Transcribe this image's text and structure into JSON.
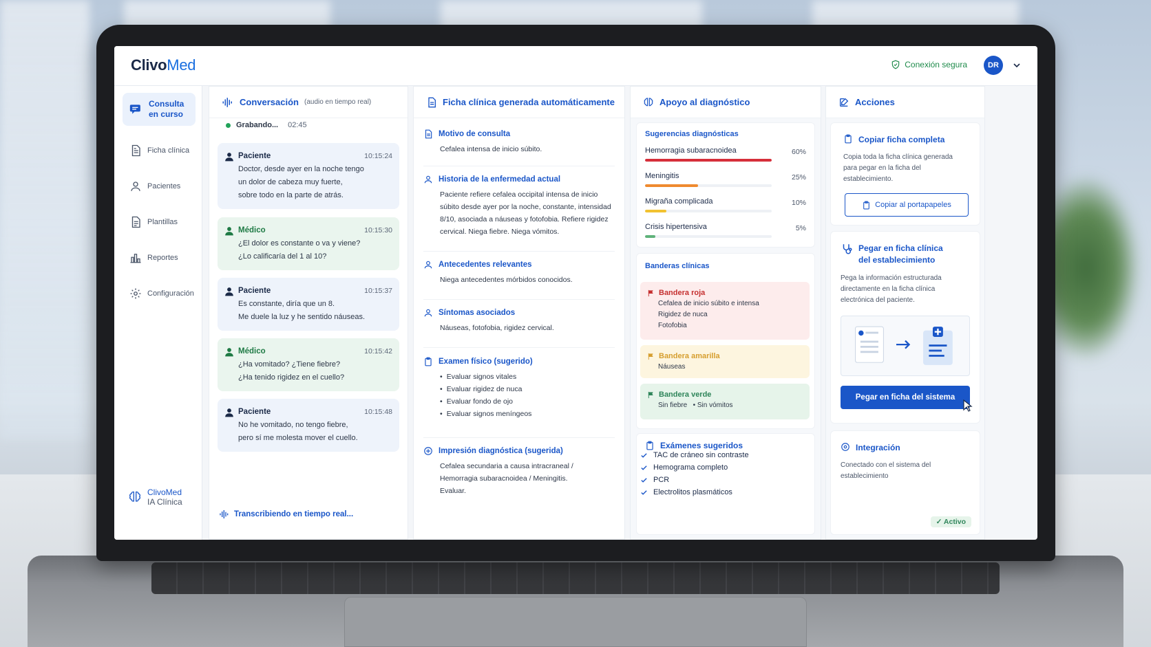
{
  "app": {
    "logo_part1": "Clivo",
    "logo_part2": "Med",
    "secure_label": "Conexión segura",
    "avatar_initials": "DR"
  },
  "sidebar": {
    "items": [
      {
        "label_line1": "Consulta",
        "label_line2": "en curso",
        "icon": "chat-icon"
      },
      {
        "label": "Ficha clínica",
        "icon": "document-icon"
      },
      {
        "label": "Pacientes",
        "icon": "user-icon"
      },
      {
        "label": "Plantillas",
        "icon": "template-icon"
      },
      {
        "label": "Reportes",
        "icon": "bar-chart-icon"
      },
      {
        "label": "Configuración",
        "icon": "gear-icon"
      }
    ],
    "brand_name": "ClivoMed",
    "brand_sub": "IA Clínica"
  },
  "conversation": {
    "title": "Conversación",
    "subtitle": "(audio en tiempo real)",
    "recording_label": "Grabando...",
    "recording_time": "02:45",
    "messages": [
      {
        "who": "Paciente",
        "time": "10:15:24",
        "lines": [
          "Doctor, desde ayer en la noche tengo",
          "un dolor de cabeza muy fuerte,",
          "sobre todo en la parte de atrás."
        ]
      },
      {
        "who": "Médico",
        "time": "10:15:30",
        "lines": [
          "¿El dolor es constante o va y viene?",
          "¿Lo calificaría del 1 al 10?"
        ]
      },
      {
        "who": "Paciente",
        "time": "10:15:37",
        "lines": [
          "Es constante, diría que un 8.",
          "Me duele la luz y he sentido náuseas."
        ]
      },
      {
        "who": "Médico",
        "time": "10:15:42",
        "lines": [
          "¿Ha vomitado? ¿Tiene fiebre?",
          "¿Ha tenido rigidez en el cuello?"
        ]
      },
      {
        "who": "Paciente",
        "time": "10:15:48",
        "lines": [
          "No he vomitado, no tengo fiebre,",
          "pero sí me molesta mover el cuello."
        ]
      }
    ],
    "transcribing_label": "Transcribiendo en tiempo real..."
  },
  "ficha": {
    "title": "Ficha clínica generada automáticamente",
    "sections": [
      {
        "title": "Motivo de consulta",
        "lines": [
          "Cefalea intensa de inicio súbito."
        ]
      },
      {
        "title": "Historia de la enfermedad actual",
        "lines": [
          "Paciente refiere cefalea occipital intensa de inicio",
          "súbito desde ayer por la noche, constante, intensidad",
          "8/10, asociada a náuseas y fotofobia. Refiere rigidez",
          "cervical. Niega fiebre. Niega vómitos."
        ]
      },
      {
        "title": "Antecedentes relevantes",
        "lines": [
          "Niega antecedentes mórbidos conocidos."
        ]
      },
      {
        "title": "Síntomas asociados",
        "lines": [
          "Náuseas, fotofobia, rigidez cervical."
        ]
      },
      {
        "title": "Examen físico (sugerido)",
        "bullets": [
          "Evaluar signos vitales",
          "Evaluar rigidez de nuca",
          "Evaluar fondo de ojo",
          "Evaluar signos meníngeos"
        ]
      },
      {
        "title": "Impresión diagnóstica (sugerida)",
        "lines": [
          "Cefalea secundaria a causa intracraneal /",
          "Hemorragia subaracnoidea / Meningitis.",
          "Evaluar."
        ]
      }
    ]
  },
  "diagnosis": {
    "title": "Apoyo al diagnóstico",
    "suggestions_title": "Sugerencias diagnósticas",
    "suggestions": [
      {
        "name": "Hemorragia subaracnoidea",
        "pct_label": "60%",
        "value": 0.6,
        "color": "#d62f3a"
      },
      {
        "name": "Meningitis",
        "pct_label": "25%",
        "value": 0.25,
        "color": "#ef8a2f"
      },
      {
        "name": "Migraña complicada",
        "pct_label": "10%",
        "value": 0.1,
        "color": "#f2c230"
      },
      {
        "name": "Crisis hipertensiva",
        "pct_label": "5%",
        "value": 0.05,
        "color": "#5fb27a"
      }
    ],
    "flags_title": "Banderas clínicas",
    "red_flag": {
      "title": "Bandera roja",
      "items": [
        "Cefalea de inicio súbito e intensa",
        "Rigidez de nuca",
        "Fotofobia"
      ]
    },
    "yellow_flag": {
      "title": "Bandera amarilla",
      "items": [
        "Náuseas"
      ]
    },
    "green_flag": {
      "title": "Bandera verde",
      "items": [
        "Sin fiebre",
        "Sin vómitos"
      ]
    },
    "exams_title": "Exámenes sugeridos",
    "exams": [
      "TAC de cráneo sin contraste",
      "Hemograma completo",
      "PCR",
      "Electrolitos plasmáticos"
    ]
  },
  "actions": {
    "title": "Acciones",
    "copy_title": "Copiar ficha completa",
    "copy_desc_lines": [
      "Copia toda la ficha clínica generada",
      "para pegar en la ficha del",
      "establecimiento."
    ],
    "copy_button": "Copiar al portapapeles",
    "paste_title_line1": "Pegar en ficha clínica",
    "paste_title_line2": "del establecimiento",
    "paste_desc_lines": [
      "Pega la información estructurada",
      "directamente en la ficha clínica",
      "electrónica del paciente."
    ],
    "paste_button": "Pegar en ficha del sistema",
    "integration_title": "Integración",
    "integration_desc_lines": [
      "Conectado con el sistema del",
      "establecimiento"
    ],
    "integration_status": "Activo"
  }
}
